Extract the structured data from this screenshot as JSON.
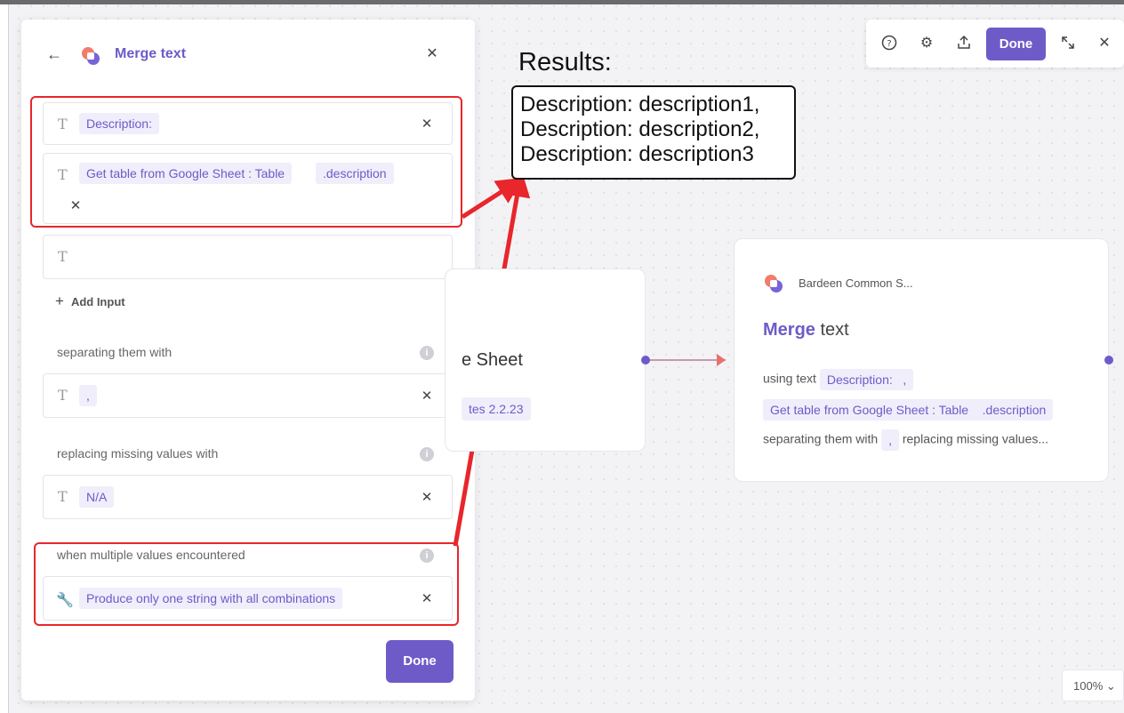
{
  "panel": {
    "title": "Merge text",
    "inputs": [
      {
        "chips": [
          "Description:"
        ]
      },
      {
        "chips": [
          "Get table from Google Sheet : Table",
          ".description"
        ]
      },
      {
        "chips": []
      }
    ],
    "add_input_label": "Add Input",
    "separator": {
      "label": "separating them with",
      "value": ","
    },
    "missing": {
      "label": "replacing missing values with",
      "value": "N/A"
    },
    "multiple": {
      "label": "when multiple values encountered",
      "value": "Produce only one string with all combinations"
    },
    "done_label": "Done"
  },
  "annotation": {
    "results_label": "Results:",
    "results_lines": [
      "Description: description1,",
      "Description: description2,",
      "Description: description3"
    ]
  },
  "toolbar": {
    "done_label": "Done"
  },
  "left_card": {
    "title": "e Sheet",
    "chip": "tes 2.2.23"
  },
  "right_card": {
    "source": "Bardeen Common S...",
    "title_accent": "Merge",
    "title_rest": " text",
    "row1_prefix": "using text",
    "row1_chip1": "Description:",
    "row1_chip2": ",",
    "row2_chip1": "Get table from Google Sheet : Table",
    "row2_chip2": ".description",
    "row3_prefix": "separating them with",
    "row3_chip": ",",
    "row3_suffix": "replacing missing values..."
  },
  "zoom": {
    "value": "100%"
  },
  "colors": {
    "accent": "#6e5bc8",
    "annotation_red": "#e8262b"
  }
}
